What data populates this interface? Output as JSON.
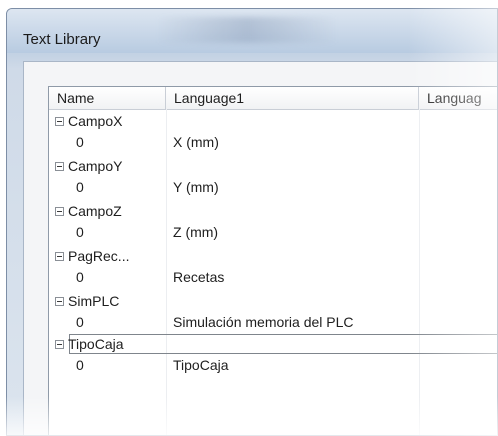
{
  "window": {
    "title": "Text Library"
  },
  "columns": [
    {
      "label": "Name"
    },
    {
      "label": "Language1"
    },
    {
      "label": "Languag"
    }
  ],
  "entries": [
    {
      "name": "CampoX",
      "child_id": "0",
      "language1": "X (mm)"
    },
    {
      "name": "CampoY",
      "child_id": "0",
      "language1": "Y (mm)"
    },
    {
      "name": "CampoZ",
      "child_id": "0",
      "language1": "Z (mm)"
    },
    {
      "name": "PagRec...",
      "child_id": "0",
      "language1": "Recetas"
    },
    {
      "name": "SimPLC",
      "child_id": "0",
      "language1": "Simulación memoria del PLC"
    },
    {
      "name": "TipoCaja",
      "child_id": "0",
      "language1": "TipoCaja",
      "selected": true
    }
  ],
  "icons": {
    "expander": "collapse-minus-icon"
  }
}
